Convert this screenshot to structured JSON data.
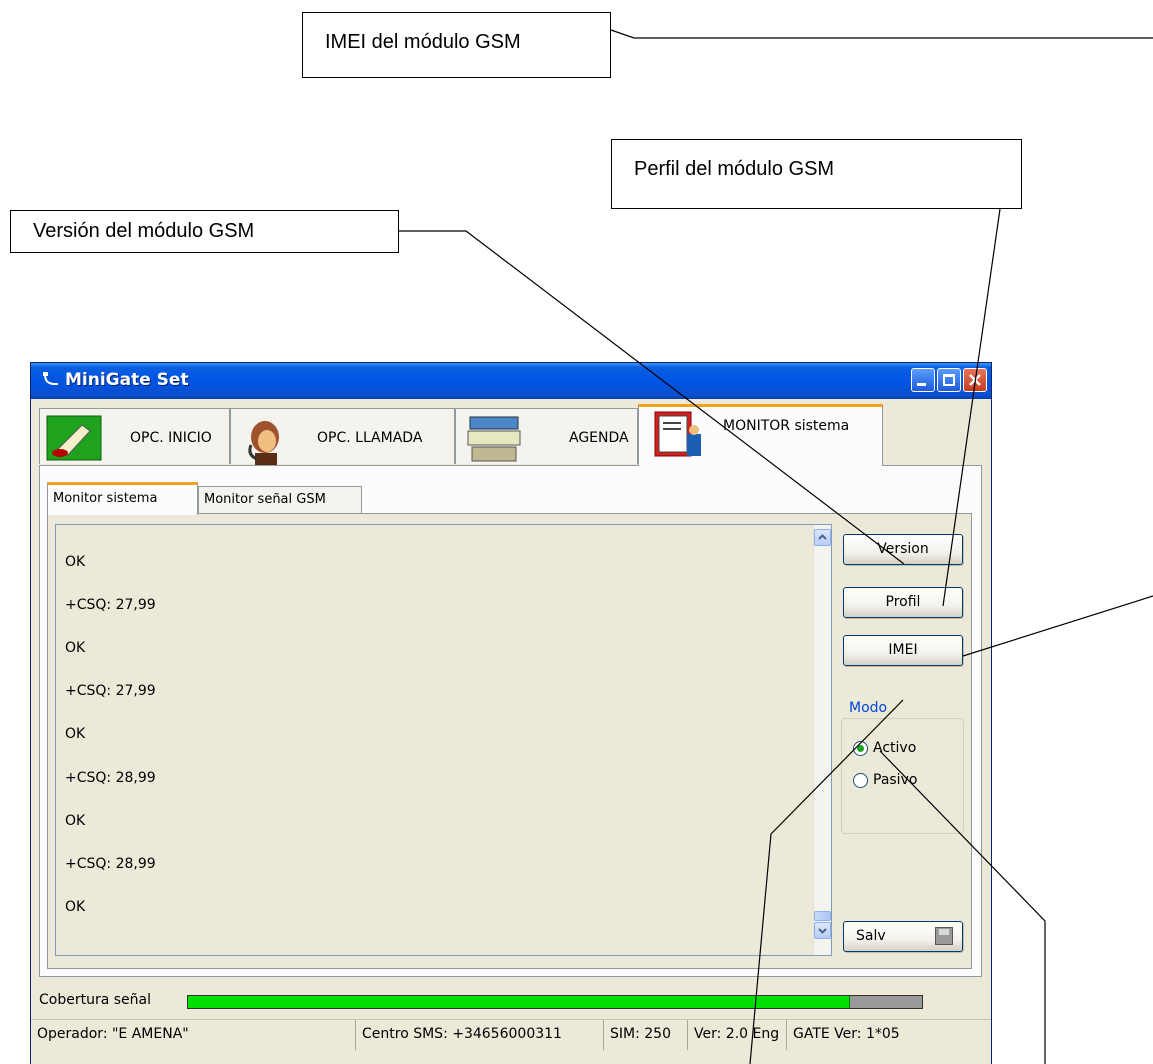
{
  "annotations": {
    "imei_callout": "IMEI del módulo GSM",
    "profile_callout": "Perfil del módulo GSM",
    "version_callout": "Versión del módulo GSM"
  },
  "window": {
    "title": "MiniGate Set"
  },
  "main_tabs": [
    {
      "label": "OPC. INICIO",
      "icon": "start-options-icon"
    },
    {
      "label": "OPC. LLAMADA",
      "icon": "phone-operator-icon"
    },
    {
      "label": "AGENDA",
      "icon": "agenda-icon"
    },
    {
      "label": "MONITOR sistema",
      "icon": "monitor-document-icon"
    }
  ],
  "sub_tabs": [
    {
      "label": "Monitor sistema"
    },
    {
      "label": "Monitor señal GSM"
    }
  ],
  "log_lines": [
    "OK",
    "+CSQ: 27,99",
    "OK",
    "+CSQ: 27,99",
    "OK",
    "+CSQ: 28,99",
    "OK",
    "+CSQ: 28,99",
    "OK"
  ],
  "buttons": {
    "version": "Version",
    "profile": "Profil",
    "imei": "IMEI",
    "save": "Salv"
  },
  "mode_group": {
    "title": "Modo",
    "options": [
      {
        "label": "Activo",
        "selected": true
      },
      {
        "label": "Pasivo",
        "selected": false
      }
    ]
  },
  "signal": {
    "label": "Cobertura señal",
    "level_fraction": 0.9,
    "fill_color": "#00e000"
  },
  "status_bar": {
    "operator": "Operador: \"E AMENA\"",
    "sms_center": "Centro SMS:  +34656000311",
    "sim": "SIM: 250",
    "version": "Ver: 2.0  Eng",
    "gate_version": "GATE Ver: 1*05"
  }
}
